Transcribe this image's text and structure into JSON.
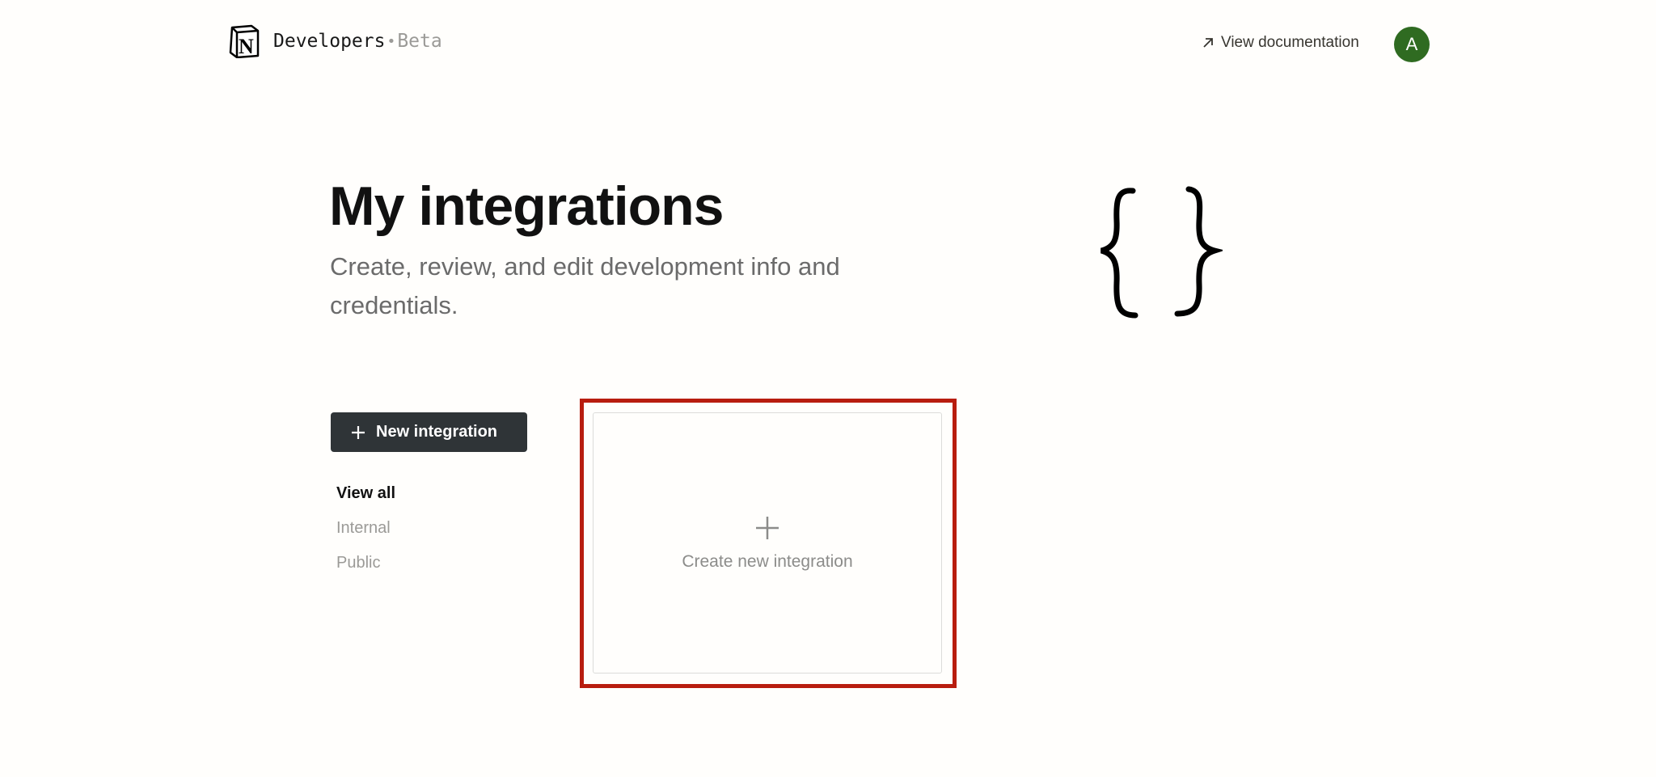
{
  "header": {
    "brand_name": "Developers",
    "brand_separator": "•",
    "brand_tag": "Beta",
    "doc_link_label": "View documentation",
    "avatar_initial": "A"
  },
  "hero": {
    "title": "My integrations",
    "subtitle": "Create, review, and edit development info and credentials."
  },
  "sidebar": {
    "new_button_label": "New integration",
    "filters": [
      {
        "label": "View all",
        "active": true
      },
      {
        "label": "Internal",
        "active": false
      },
      {
        "label": "Public",
        "active": false
      }
    ]
  },
  "create_card": {
    "label": "Create new integration"
  },
  "colors": {
    "background": "#fffefc",
    "button_bg": "#2f3437",
    "avatar_bg": "#2f6b21",
    "highlight_border": "#b81d0f"
  },
  "icons": [
    "notion-logo-icon",
    "arrow-up-right-icon",
    "plus-icon",
    "curly-braces-icon"
  ]
}
